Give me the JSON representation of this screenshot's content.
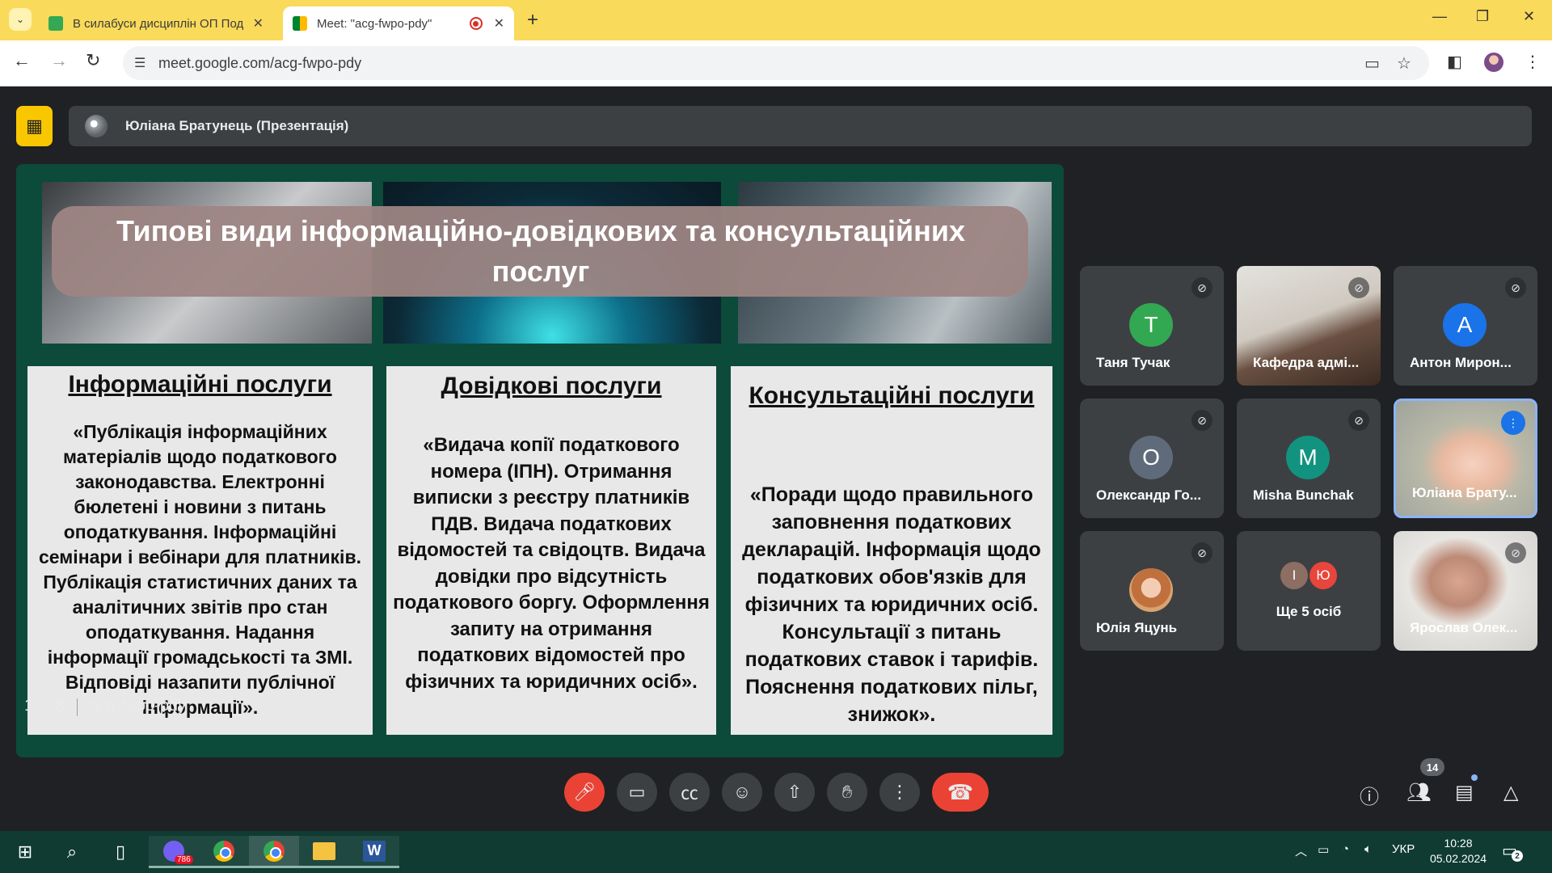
{
  "browser": {
    "tabs": [
      {
        "title": "В силабуси дисциплін ОП Под",
        "close": "✕"
      },
      {
        "title": "Meet: \"acg-fwpo-pdy\"",
        "close": "✕"
      }
    ],
    "new_tab": "+",
    "url": "meet.google.com/acg-fwpo-pdy",
    "accent_color": "#f9da5a"
  },
  "presentation": {
    "presenter": "Юліана Братунець (Презентація)",
    "slide": {
      "title": "Типові види інформаційно-довідкових та консультаційних послуг",
      "columns": [
        {
          "heading": "Інформаційні послуги",
          "text": "«Публікація інформаційних матеріалів щодо податкового законодавства. Електронні бюлетені і новини з питань оподаткування. Інформаційні семінари і вебінари для платників. Публікація статистичних даних та аналітичних звітів про стан оподаткування. Надання інформації громадськості та ЗМІ. Відповіді назапити публічної інформації»."
        },
        {
          "heading": "Довідкові послуги",
          "text": "«Видача копії податкового номера (ІПН). Отримання виписки з реєстру платників ПДВ. Видача податкових відомостей та свідоцтв. Видача довідки про відсутність податкового боргу. Оформлення запиту на отримання податкових відомостей про фізичних та юридичних осіб»."
        },
        {
          "heading": "Консультаційні послуги",
          "text": "«Поради щодо правильного заповнення податкових декларацій. Інформація щодо податкових обов'язків для фізичних та юридичних осіб. Консультації з питань податкових ставок і тарифів. Пояснення податкових пільг, знижок»."
        }
      ]
    }
  },
  "participants": [
    {
      "name": "Таня Тучак",
      "initial": "Т",
      "color": "#33a852",
      "muted": true
    },
    {
      "name": "Кафедра адмі...",
      "video": true,
      "muted": true
    },
    {
      "name": "Антон Мирон...",
      "initial": "А",
      "color": "#1a73e8",
      "muted": true
    },
    {
      "name": "Олександр Го...",
      "initial": "О",
      "color": "#5f6b7a",
      "muted": true
    },
    {
      "name": "Misha Bunchak",
      "initial": "M",
      "color": "#12937f",
      "muted": true
    },
    {
      "name": "Юліана Брату...",
      "video": true,
      "speaking": true
    },
    {
      "name": "Юлія Яцунь",
      "photo": true,
      "muted": true
    },
    {
      "name": "Ще 5 осіб",
      "initials": [
        "І",
        "Ю"
      ],
      "colors": [
        "#8d6e63",
        "#e8453c"
      ]
    },
    {
      "name": "Ярослав Олек...",
      "video": true,
      "muted": true
    }
  ],
  "controls": {
    "time": "10:28",
    "meeting_code": "acg-fwpo-pdy",
    "participant_count": "14"
  },
  "taskbar": {
    "viber_badge": "786",
    "language": "УКР",
    "time": "10:28",
    "date": "05.02.2024",
    "notifications": "2"
  }
}
